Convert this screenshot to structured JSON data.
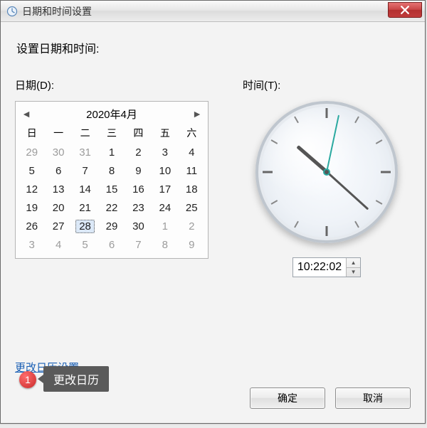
{
  "window": {
    "title": "日期和时间设置",
    "subtitle": "设置日期和时间:"
  },
  "date": {
    "group_label": "日期(D):",
    "month_label": "2020年4月",
    "dow": [
      "日",
      "一",
      "二",
      "三",
      "四",
      "五",
      "六"
    ],
    "cells": [
      {
        "n": 29,
        "t": "other"
      },
      {
        "n": 30,
        "t": "other"
      },
      {
        "n": 31,
        "t": "other"
      },
      {
        "n": 1,
        "t": "cur"
      },
      {
        "n": 2,
        "t": "cur"
      },
      {
        "n": 3,
        "t": "cur"
      },
      {
        "n": 4,
        "t": "cur"
      },
      {
        "n": 5,
        "t": "cur"
      },
      {
        "n": 6,
        "t": "cur"
      },
      {
        "n": 7,
        "t": "cur"
      },
      {
        "n": 8,
        "t": "cur"
      },
      {
        "n": 9,
        "t": "cur"
      },
      {
        "n": 10,
        "t": "cur"
      },
      {
        "n": 11,
        "t": "cur"
      },
      {
        "n": 12,
        "t": "cur"
      },
      {
        "n": 13,
        "t": "cur"
      },
      {
        "n": 14,
        "t": "cur"
      },
      {
        "n": 15,
        "t": "cur"
      },
      {
        "n": 16,
        "t": "cur"
      },
      {
        "n": 17,
        "t": "cur"
      },
      {
        "n": 18,
        "t": "cur"
      },
      {
        "n": 19,
        "t": "cur"
      },
      {
        "n": 20,
        "t": "cur"
      },
      {
        "n": 21,
        "t": "cur"
      },
      {
        "n": 22,
        "t": "cur"
      },
      {
        "n": 23,
        "t": "cur"
      },
      {
        "n": 24,
        "t": "cur"
      },
      {
        "n": 25,
        "t": "cur"
      },
      {
        "n": 26,
        "t": "cur"
      },
      {
        "n": 27,
        "t": "cur"
      },
      {
        "n": 28,
        "t": "sel"
      },
      {
        "n": 29,
        "t": "cur"
      },
      {
        "n": 30,
        "t": "cur"
      },
      {
        "n": 1,
        "t": "other"
      },
      {
        "n": 2,
        "t": "other"
      },
      {
        "n": 3,
        "t": "other"
      },
      {
        "n": 4,
        "t": "other"
      },
      {
        "n": 5,
        "t": "other"
      },
      {
        "n": 6,
        "t": "other"
      },
      {
        "n": 7,
        "t": "other"
      },
      {
        "n": 8,
        "t": "other"
      },
      {
        "n": 9,
        "t": "other"
      }
    ]
  },
  "time": {
    "group_label": "时间(T):",
    "value": "10:22:02",
    "hour": 10,
    "minute": 22,
    "second": 2
  },
  "link": {
    "label": "更改日历设置"
  },
  "annotation": {
    "badge": "1",
    "tooltip": "更改日历"
  },
  "buttons": {
    "ok": "确定",
    "cancel": "取消"
  }
}
